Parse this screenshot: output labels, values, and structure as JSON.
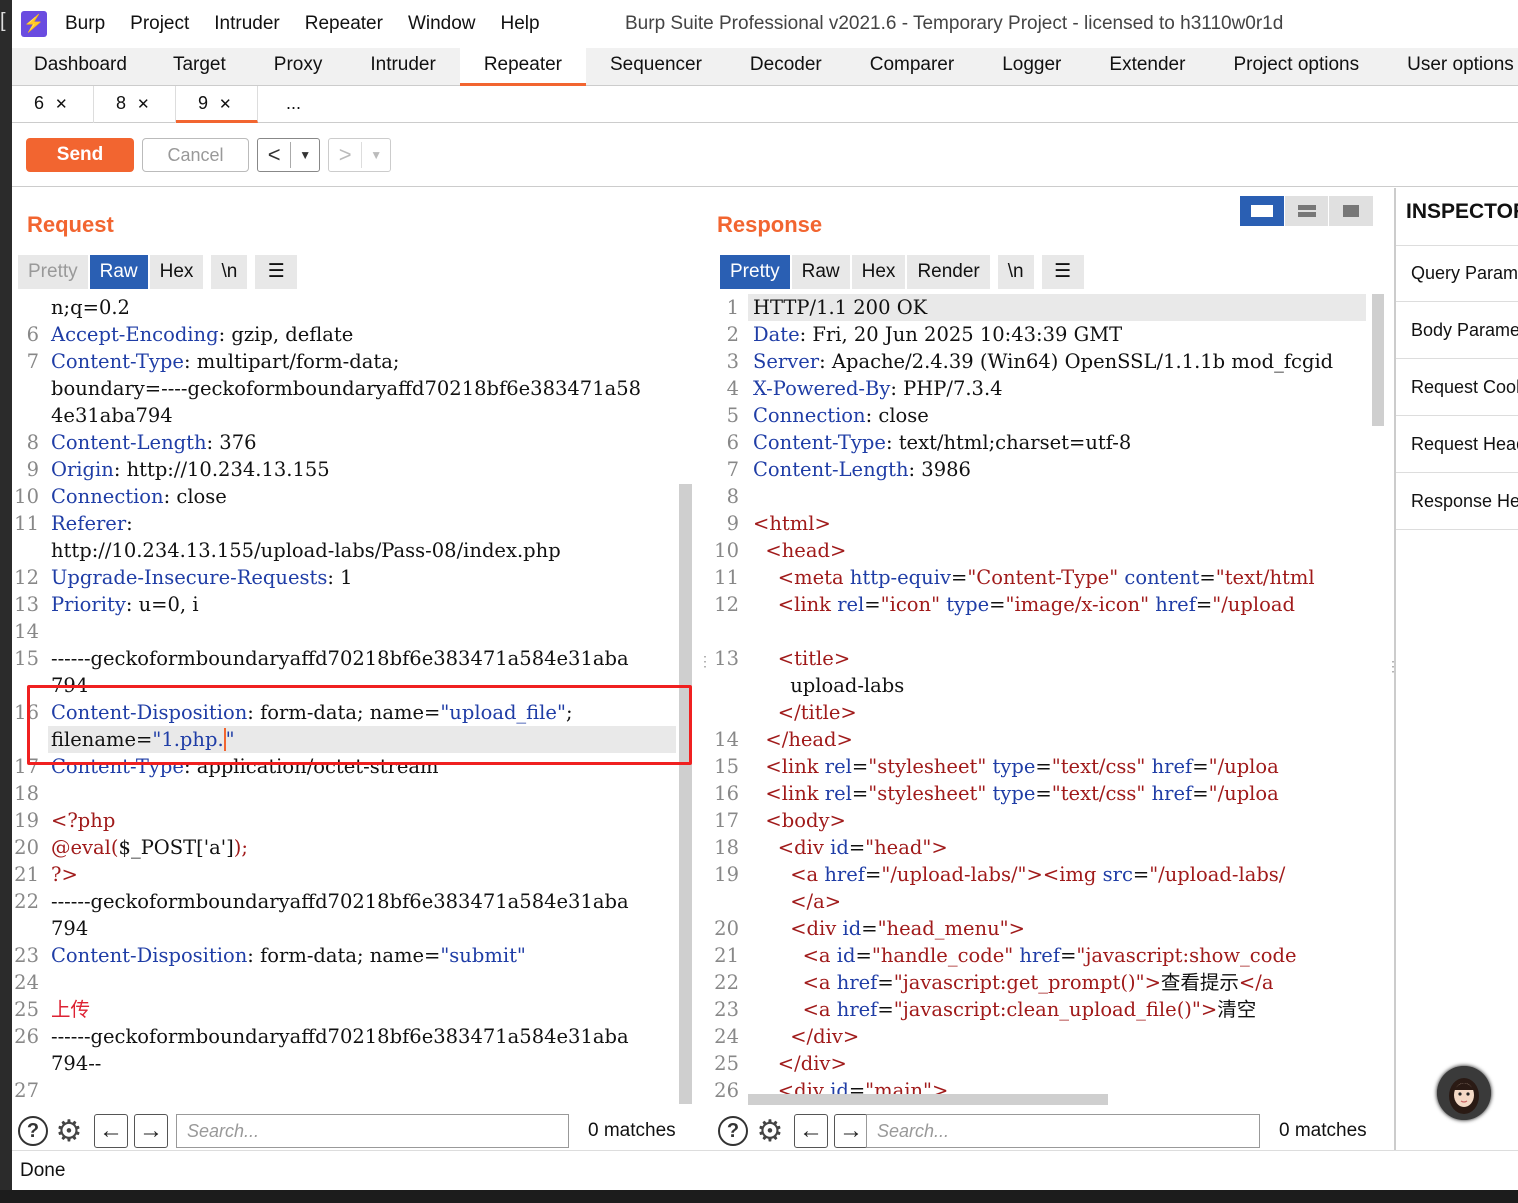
{
  "window": {
    "title": "Burp Suite Professional v2021.6 - Temporary Project - licensed to h3110w0r1d"
  },
  "menu": [
    "Burp",
    "Project",
    "Intruder",
    "Repeater",
    "Window",
    "Help"
  ],
  "tabs": [
    "Dashboard",
    "Target",
    "Proxy",
    "Intruder",
    "Repeater",
    "Sequencer",
    "Decoder",
    "Comparer",
    "Logger",
    "Extender",
    "Project options",
    "User options"
  ],
  "active_tab": "Repeater",
  "subtabs": [
    "6",
    "8",
    "9",
    "..."
  ],
  "active_subtab": "9",
  "toolbar": {
    "send": "Send",
    "cancel": "Cancel",
    "back": "<",
    "forward": ">"
  },
  "request": {
    "title": "Request",
    "view_tabs": [
      "Pretty",
      "Raw",
      "Hex",
      "\\n"
    ],
    "selected_view": "Raw",
    "search_placeholder": "Search...",
    "matches": "0 matches"
  },
  "response": {
    "title": "Response",
    "view_tabs": [
      "Pretty",
      "Raw",
      "Hex",
      "Render",
      "\\n"
    ],
    "selected_view": "Pretty",
    "search_placeholder": "Search...",
    "matches": "0 matches"
  },
  "inspector": {
    "title": "INSPECTOR",
    "sections": [
      "Query Parameters",
      "Body Parameters",
      "Request Cookies",
      "Request Headers",
      "Response Headers"
    ]
  },
  "status": "Done",
  "colors": {
    "accent": "#f26530",
    "selected": "#2a5fb3",
    "highlight_box": "#f02020"
  }
}
